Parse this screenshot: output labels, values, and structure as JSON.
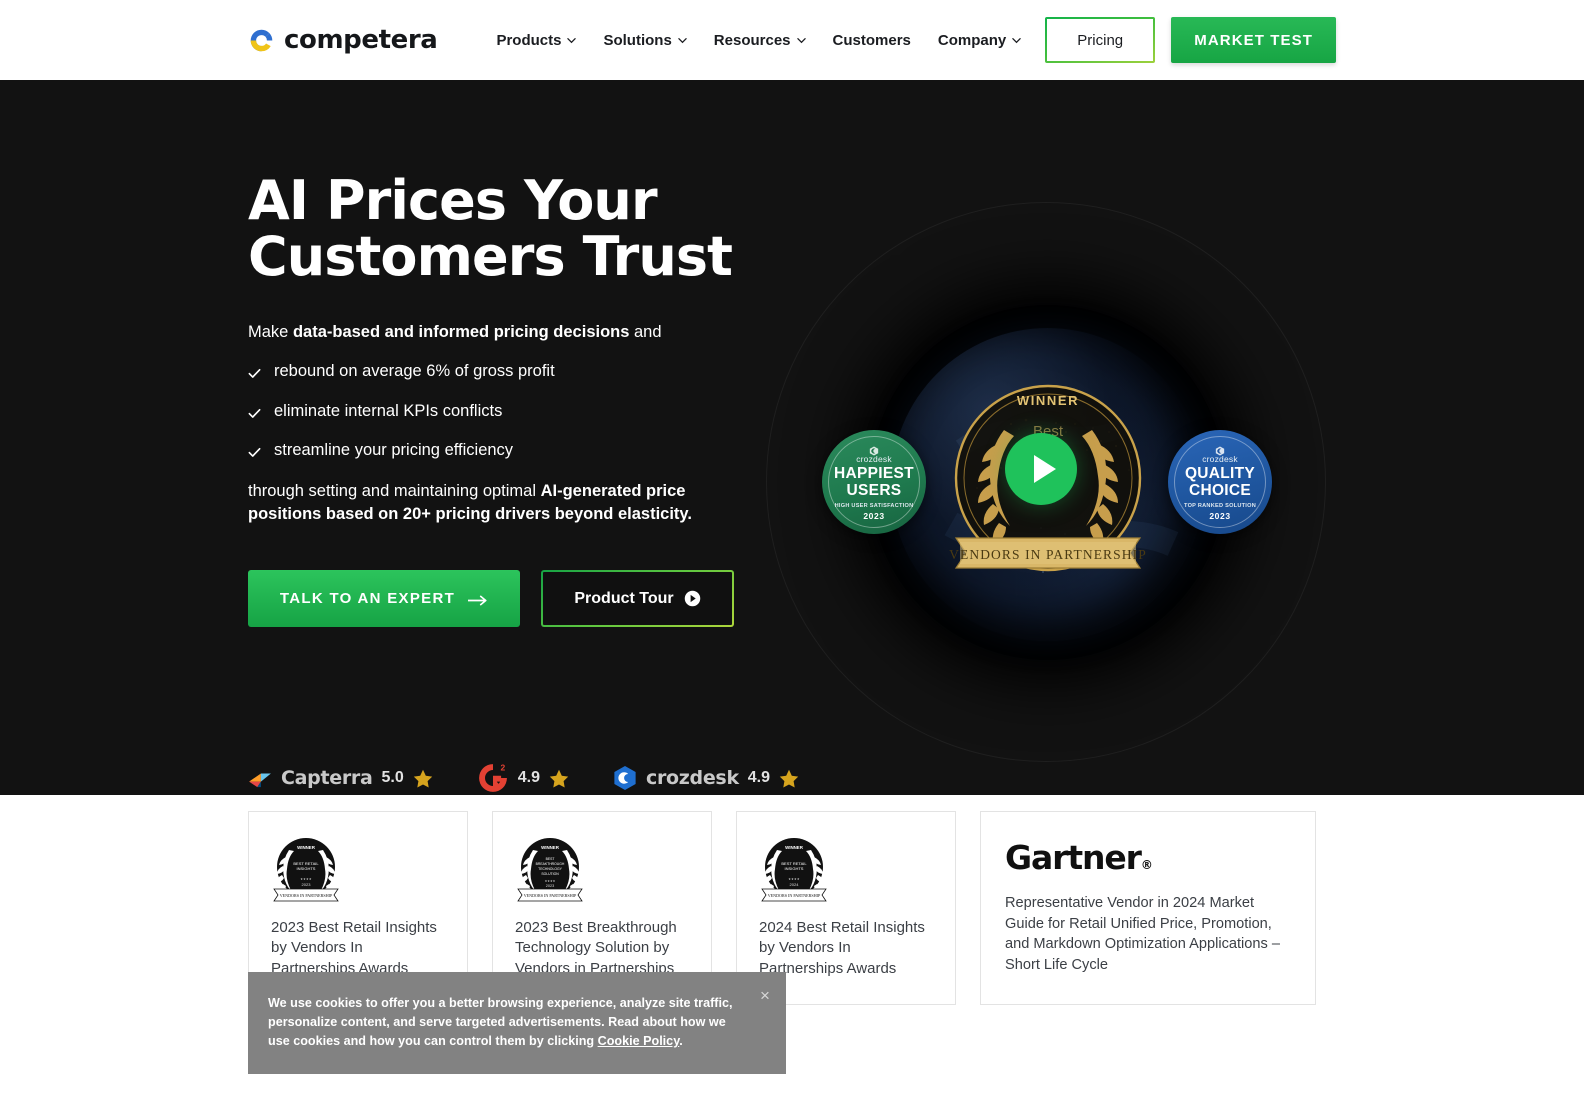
{
  "header": {
    "logo": {
      "word": "competera",
      "icon": "competera-circle-logo"
    },
    "nav": [
      {
        "label": "Products",
        "has_caret": true
      },
      {
        "label": "Solutions",
        "has_caret": true
      },
      {
        "label": "Resources",
        "has_caret": true
      },
      {
        "label": "Customers",
        "has_caret": false
      },
      {
        "label": "Company",
        "has_caret": true
      }
    ],
    "pricing_label": "Pricing",
    "market_test_label": "MARKET TEST"
  },
  "hero": {
    "title_line1": "AI Prices Your",
    "title_line2": "Customers Trust",
    "lead_pre": "Make ",
    "lead_bold": "data-based and informed pricing decisions",
    "lead_post": " and",
    "bullets": [
      "rebound on average 6% of gross profit",
      "eliminate internal KPIs conflicts",
      "streamline your pricing efficiency"
    ],
    "foot_pre": "through setting and maintaining optimal ",
    "foot_bold": "AI-generated price positions based on 20+ pricing drivers beyond elasticity.",
    "cta_primary": "TALK TO AN EXPERT",
    "cta_secondary": "Product Tour",
    "ratings": [
      {
        "name": "Capterra",
        "score": "5.0",
        "icon": "capterra-icon"
      },
      {
        "name": "",
        "score": "4.9",
        "icon": "g2-icon"
      },
      {
        "name": "crozdesk",
        "score": "4.9",
        "icon": "crozdesk-icon"
      }
    ],
    "badge_green": {
      "brand": "crozdesk",
      "title_line1": "HAPPIEST",
      "title_line2": "USERS",
      "subtitle": "HIGH USER SATISFACTION",
      "year": "2023"
    },
    "badge_blue": {
      "brand": "crozdesk",
      "title_line1": "QUALITY",
      "title_line2": "CHOICE",
      "subtitle": "TOP RANKED SOLUTION",
      "year": "2023"
    },
    "laurel": {
      "top": "WINNER",
      "middle": "Best",
      "ribbon": "VENDORS IN PARTNERSHIP"
    }
  },
  "awards": [
    {
      "medal": "winner-laurel-medal",
      "text": "2023 Best Retail Insights by Vendors In Partnerships Awards"
    },
    {
      "medal": "winner-laurel-medal",
      "text": "2023 Best Breakthrough Technology Solution by Vendors in Partnerships Awards"
    },
    {
      "medal": "winner-laurel-medal",
      "text": "2024 Best Retail Insights by Vendors In Partnerships Awards"
    }
  ],
  "gartner": {
    "logo_word": "Gartner",
    "text": "Representative Vendor in 2024 Market Guide for Retail Unified Price, Promotion, and Markdown Optimization Applications – Short Life Cycle"
  },
  "cookie": {
    "text_part1": "We use cookies to offer you a better browsing experience, analyze site traffic, personalize content, and serve targeted advertisements. Read about how we use cookies and how you can control them by clicking ",
    "link": "Cookie Policy",
    "text_part2": ".",
    "close_label": "×"
  },
  "colors": {
    "brand_green": "#17a544",
    "hero_bg": "#121212",
    "accent_lime": "#9ed13c",
    "badge_green": "#1f7a4e",
    "badge_blue": "#1f569f",
    "star_gold": "#d6a41e",
    "cookie_bg": "#828282"
  }
}
